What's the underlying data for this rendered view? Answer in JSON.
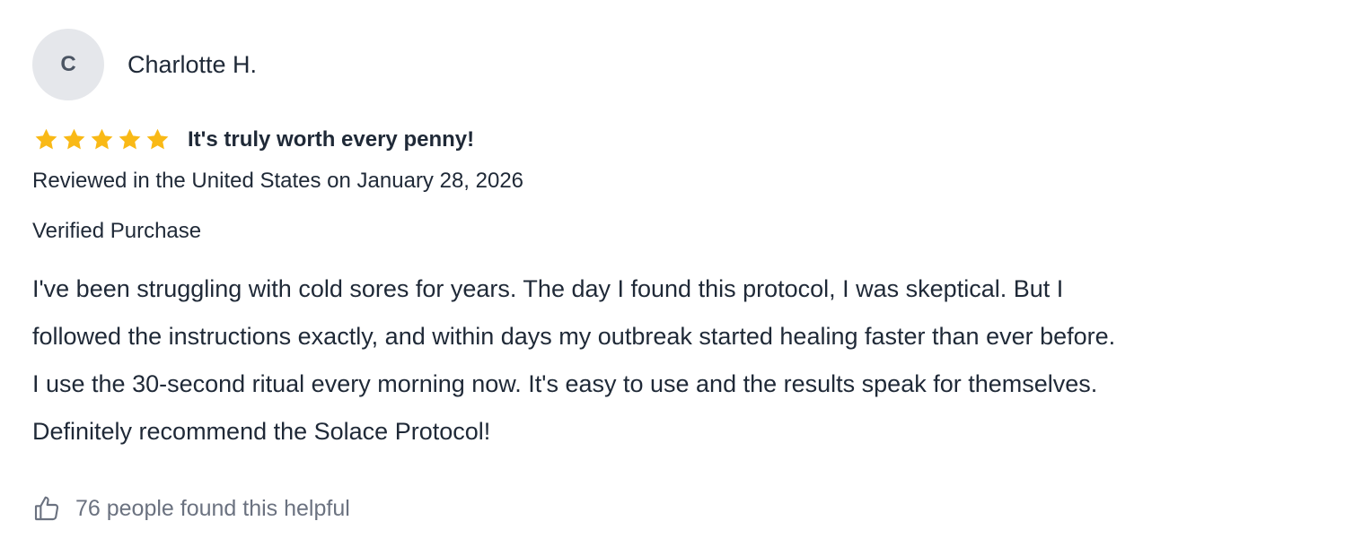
{
  "review": {
    "avatar_initial": "C",
    "reviewer_name": "Charlotte H.",
    "rating": 5,
    "rating_max": 5,
    "star_color": "#f9b916",
    "star_icon": "star-icon",
    "title": "It's truly worth every penny!",
    "date_line": "Reviewed in the United States on January 28, 2026",
    "verified_label": "Verified Purchase",
    "body_lines": [
      "I've been struggling with cold sores for years. The day I found this protocol, I was skeptical. But I",
      "followed the instructions exactly, and within days my outbreak started healing faster than ever before.",
      "I use the 30-second ritual every morning now. It's easy to use and the results speak for themselves.",
      "Definitely recommend the Solace Protocol!"
    ],
    "helpful_icon": "thumbs-up-icon",
    "helpful_text": "76 people found this helpful"
  }
}
